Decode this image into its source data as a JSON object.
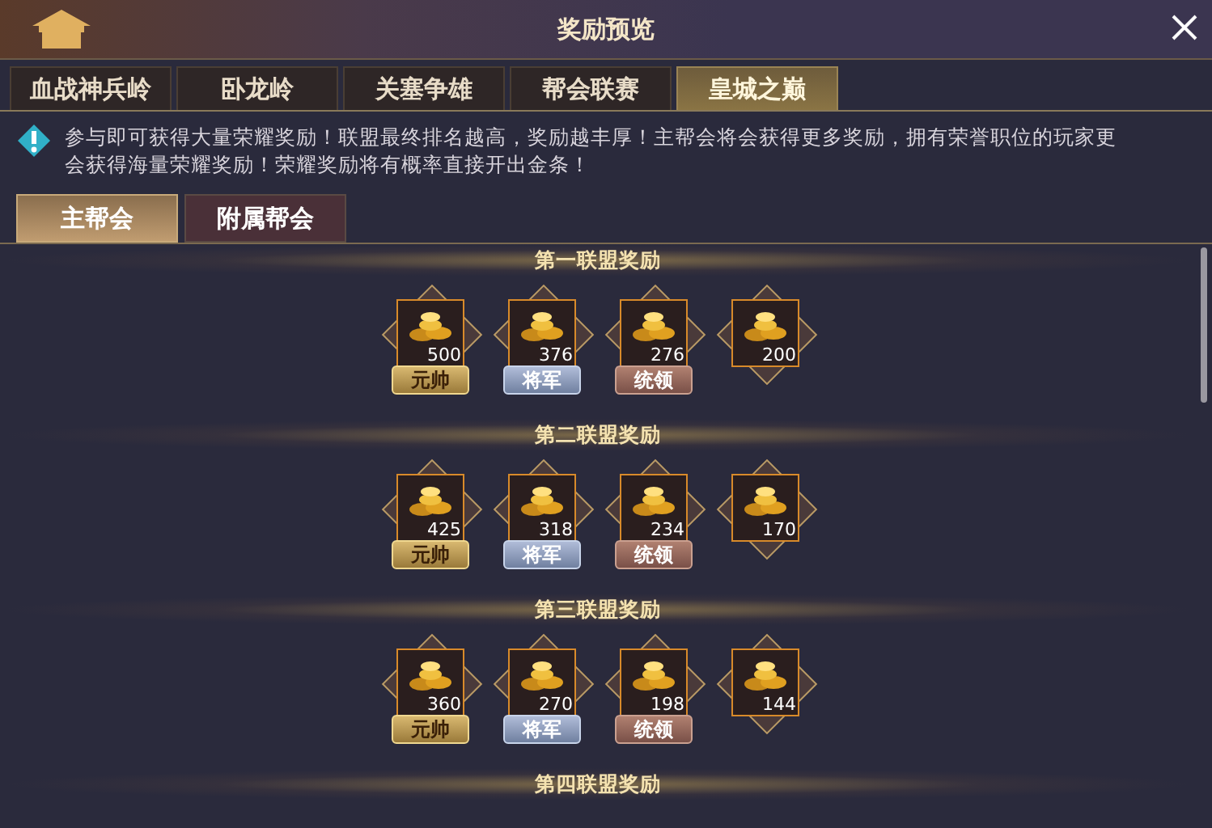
{
  "window": {
    "title": "奖励预览"
  },
  "tabs": [
    {
      "label": "血战神兵岭",
      "selected": false
    },
    {
      "label": "卧龙岭",
      "selected": false
    },
    {
      "label": "关塞争雄",
      "selected": false
    },
    {
      "label": "帮会联赛",
      "selected": false
    },
    {
      "label": "皇城之巅",
      "selected": true
    }
  ],
  "notice": "参与即可获得大量荣耀奖励！联盟最终排名越高，奖励越丰厚！主帮会将会获得更多奖励，拥有荣誉职位的玩家更会获得海量荣耀奖励！荣耀奖励将有概率直接开出金条！",
  "sub_tabs": [
    {
      "label": "主帮会",
      "selected": true
    },
    {
      "label": "附属帮会",
      "selected": false
    }
  ],
  "sections": [
    {
      "title": "第一联盟奖励",
      "rewards": [
        {
          "count": "500",
          "tag": "元帅",
          "kind": "gold"
        },
        {
          "count": "376",
          "tag": "将军",
          "kind": "silver"
        },
        {
          "count": "276",
          "tag": "统领",
          "kind": "bronze"
        },
        {
          "count": "200"
        }
      ]
    },
    {
      "title": "第二联盟奖励",
      "rewards": [
        {
          "count": "425",
          "tag": "元帅",
          "kind": "gold"
        },
        {
          "count": "318",
          "tag": "将军",
          "kind": "silver"
        },
        {
          "count": "234",
          "tag": "统领",
          "kind": "bronze"
        },
        {
          "count": "170"
        }
      ]
    },
    {
      "title": "第三联盟奖励",
      "rewards": [
        {
          "count": "360",
          "tag": "元帅",
          "kind": "gold"
        },
        {
          "count": "270",
          "tag": "将军",
          "kind": "silver"
        },
        {
          "count": "198",
          "tag": "统领",
          "kind": "bronze"
        },
        {
          "count": "144"
        }
      ]
    },
    {
      "title": "第四联盟奖励"
    }
  ]
}
